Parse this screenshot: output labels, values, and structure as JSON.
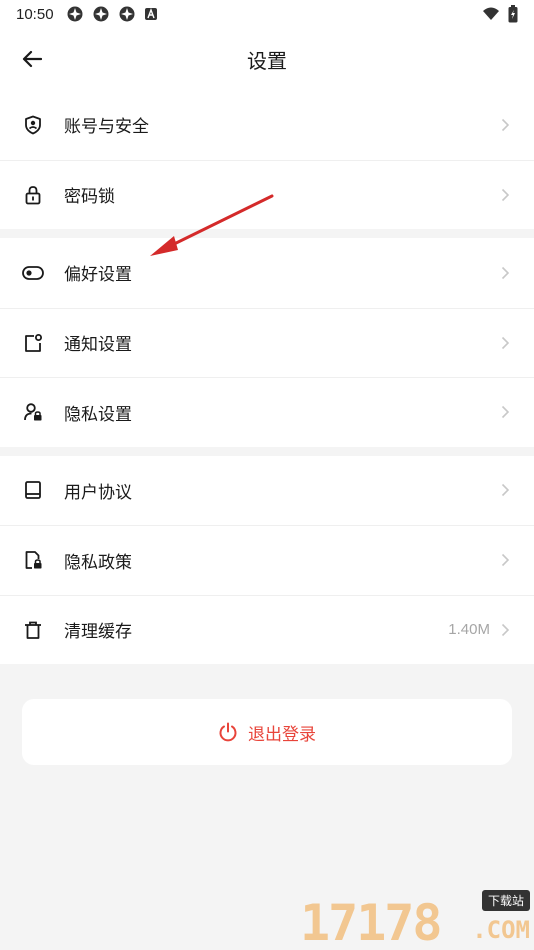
{
  "status_bar": {
    "time": "10:50",
    "icons": [
      "app-icon",
      "app-icon",
      "app-icon",
      "a-icon"
    ],
    "right_icons": [
      "wifi-icon",
      "battery-icon"
    ]
  },
  "header": {
    "title": "设置",
    "back_icon": "arrow-left-icon"
  },
  "groups": [
    {
      "items": [
        {
          "label": "账号与安全",
          "icon": "shield-user-icon"
        },
        {
          "label": "密码锁",
          "icon": "lock-icon"
        }
      ]
    },
    {
      "items": [
        {
          "label": "偏好设置",
          "icon": "toggle-icon"
        },
        {
          "label": "通知设置",
          "icon": "notification-icon"
        },
        {
          "label": "隐私设置",
          "icon": "user-lock-icon"
        }
      ]
    },
    {
      "items": [
        {
          "label": "用户协议",
          "icon": "book-icon"
        },
        {
          "label": "隐私政策",
          "icon": "file-lock-icon"
        },
        {
          "label": "清理缓存",
          "icon": "trash-icon",
          "value": "1.40M"
        }
      ]
    }
  ],
  "logout": {
    "label": "退出登录",
    "icon": "power-icon",
    "color": "#e8443a"
  },
  "watermark": {
    "digits": "17178",
    "badge": "下载站",
    "domain": ".COM"
  },
  "colors": {
    "background": "#f4f4f4",
    "card": "#ffffff",
    "accent_red": "#e8443a",
    "chevron": "#c8c8c8",
    "annotation_arrow": "#d42a2a"
  }
}
